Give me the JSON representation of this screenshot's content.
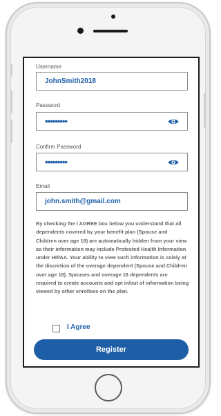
{
  "form": {
    "username_label": "Username",
    "username_value": "JohnSmith2018",
    "password_label": "Password",
    "password_value": "•••••••••",
    "confirm_label": "Confirm Password",
    "confirm_value": "•••••••••",
    "email_label": "Email",
    "email_value": "john.smith@gmail.com",
    "disclaimer": "By checking the I AGREE box below you understand that all dependents covered by your benefit plan (Spouse and Children over age 18) are automatically hidden from your view as their information may include Protected Health Information under HIPAA. Your ability to view such information is solely at the discretion of the overage dependent (Spouse and Children over age 18). Spouses and overage 18 dependents are required to create accounts and opt in/out of information being viewed by other enrollees on the plan.",
    "agree_label": "I Agree",
    "agree_checked": false,
    "register_label": "Register"
  },
  "icons": {
    "password_toggle": "eye-icon",
    "confirm_toggle": "eye-icon"
  },
  "colors": {
    "accent": "#1d5ea6",
    "text_value": "#1c5fa8",
    "label": "#555555"
  }
}
